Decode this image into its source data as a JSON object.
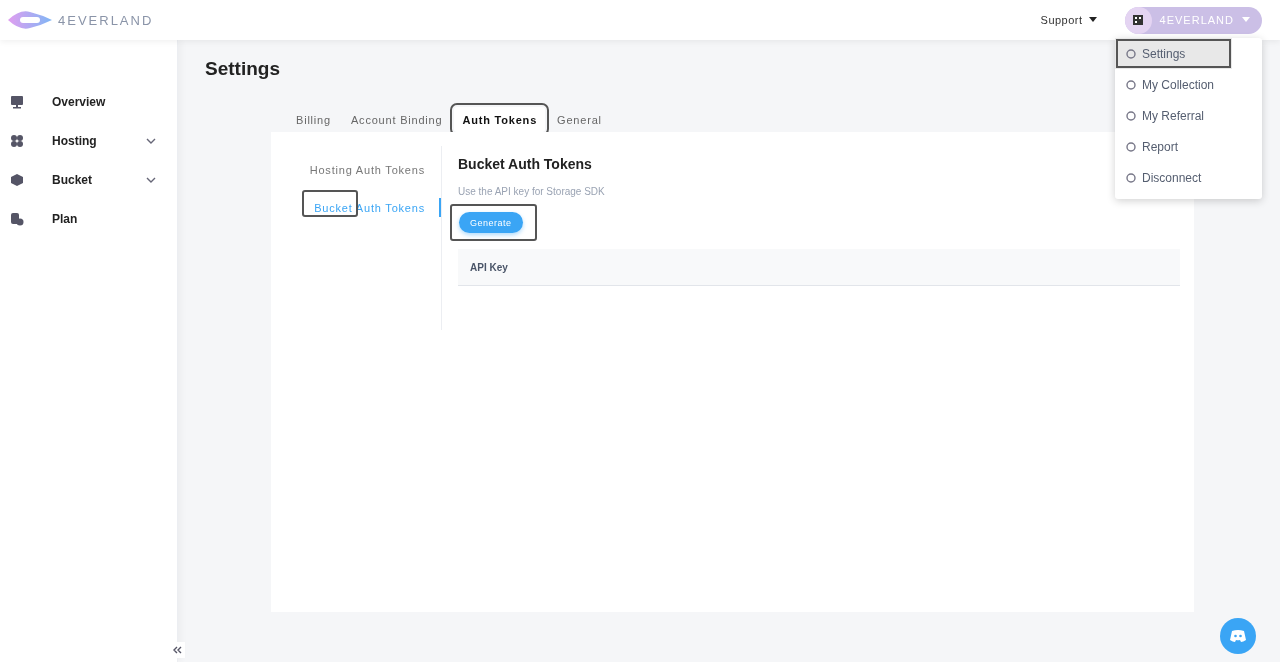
{
  "header": {
    "logo_text": "4EVERLAND",
    "support": "Support",
    "account": "4EVERLAND"
  },
  "account_menu": [
    {
      "label": "Settings",
      "selected": true,
      "highlighted": true
    },
    {
      "label": "My Collection",
      "selected": false,
      "highlighted": false
    },
    {
      "label": "My Referral",
      "selected": false,
      "highlighted": false
    },
    {
      "label": "Report",
      "selected": false,
      "highlighted": false
    },
    {
      "label": "Disconnect",
      "selected": false,
      "highlighted": false
    }
  ],
  "sidebar": {
    "items": [
      {
        "label": "Overview",
        "expandable": false
      },
      {
        "label": "Hosting",
        "expandable": true
      },
      {
        "label": "Bucket",
        "expandable": true
      },
      {
        "label": "Plan",
        "expandable": false
      }
    ]
  },
  "page_title": "Settings",
  "tabs": [
    {
      "label": "Billing",
      "selected": false,
      "highlighted": false
    },
    {
      "label": "Account Binding",
      "selected": false,
      "highlighted": false
    },
    {
      "label": "Auth Tokens",
      "selected": true,
      "highlighted": true
    },
    {
      "label": "General",
      "selected": false,
      "highlighted": false
    }
  ],
  "subtabs": [
    {
      "label": "Hosting Auth Tokens",
      "selected": false,
      "highlighted": false
    },
    {
      "label": "Bucket Auth Tokens",
      "selected": true,
      "highlighted": true
    }
  ],
  "panel": {
    "title": "Bucket Auth Tokens",
    "description": "Use the API key for Storage SDK",
    "button": {
      "label": "Generate",
      "highlighted": true
    },
    "table": {
      "columns": [
        "API Key"
      ]
    }
  }
}
